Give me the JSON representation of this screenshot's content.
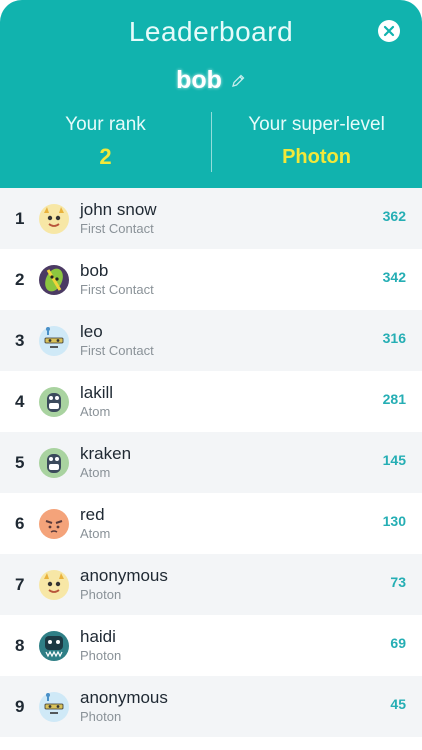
{
  "header": {
    "title": "Leaderboard",
    "username": "bob",
    "rank_label": "Your rank",
    "rank_value": "2",
    "level_label": "Your super-level",
    "level_value": "Photon"
  },
  "colors": {
    "header_bg": "#11b3ae",
    "highlight": "#f2e83a",
    "score": "#25aeb4"
  },
  "leaderboard": [
    {
      "rank": "1",
      "name": "john snow",
      "level": "First Contact",
      "score": "362",
      "avatar": "yellow-spiky-creature-avatar"
    },
    {
      "rank": "2",
      "name": "bob",
      "level": "First Contact",
      "score": "342",
      "avatar": "purple-pickle-creature-avatar"
    },
    {
      "rank": "3",
      "name": "leo",
      "level": "First Contact",
      "score": "316",
      "avatar": "blue-antenna-creature-avatar"
    },
    {
      "rank": "4",
      "name": "lakill",
      "level": "Atom",
      "score": "281",
      "avatar": "green-monster-avatar"
    },
    {
      "rank": "5",
      "name": "kraken",
      "level": "Atom",
      "score": "145",
      "avatar": "green-monster-avatar"
    },
    {
      "rank": "6",
      "name": "red",
      "level": "Atom",
      "score": "130",
      "avatar": "orange-blob-avatar"
    },
    {
      "rank": "7",
      "name": "anonymous",
      "level": "Photon",
      "score": "73",
      "avatar": "yellow-spiky-creature-avatar"
    },
    {
      "rank": "8",
      "name": "haidi",
      "level": "Photon",
      "score": "69",
      "avatar": "teal-toothy-creature-avatar"
    },
    {
      "rank": "9",
      "name": "anonymous",
      "level": "Photon",
      "score": "45",
      "avatar": "blue-antenna-creature-avatar"
    }
  ]
}
